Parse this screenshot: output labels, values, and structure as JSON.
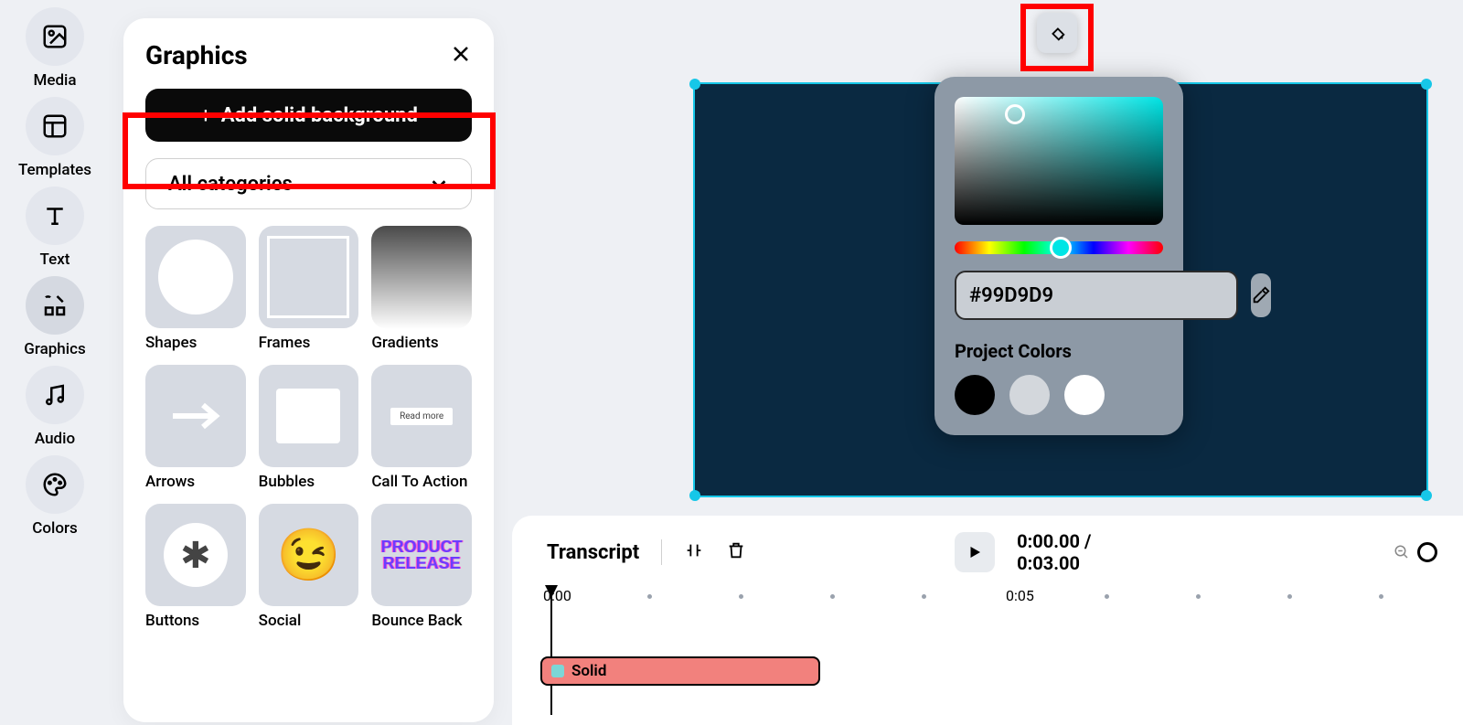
{
  "sidebar": {
    "items": [
      {
        "label": "Media"
      },
      {
        "label": "Templates"
      },
      {
        "label": "Text"
      },
      {
        "label": "Graphics"
      },
      {
        "label": "Audio"
      },
      {
        "label": "Colors"
      }
    ]
  },
  "panel": {
    "title": "Graphics",
    "add_bg_label": "Add solid background",
    "category_label": "All categories",
    "tiles": {
      "shapes": "Shapes",
      "frames": "Frames",
      "gradients": "Gradients",
      "arrows": "Arrows",
      "bubbles": "Bubbles",
      "cta": "Call To Action",
      "buttons": "Buttons",
      "social": "Social",
      "bounce": "Bounce Back",
      "bounce_text": "PRODUCT RELEASE",
      "cta_text": "Read more"
    }
  },
  "picker": {
    "hex": "#99D9D9",
    "project_colors_label": "Project Colors",
    "project_colors": [
      "#000000",
      "#d3d7dc",
      "#ffffff"
    ]
  },
  "timeline": {
    "transcript_label": "Transcript",
    "current": "0:00.00",
    "sep": "/",
    "total": "0:03.00",
    "mark0": "0:00",
    "mark5": "0:05",
    "clip_label": "Solid"
  }
}
